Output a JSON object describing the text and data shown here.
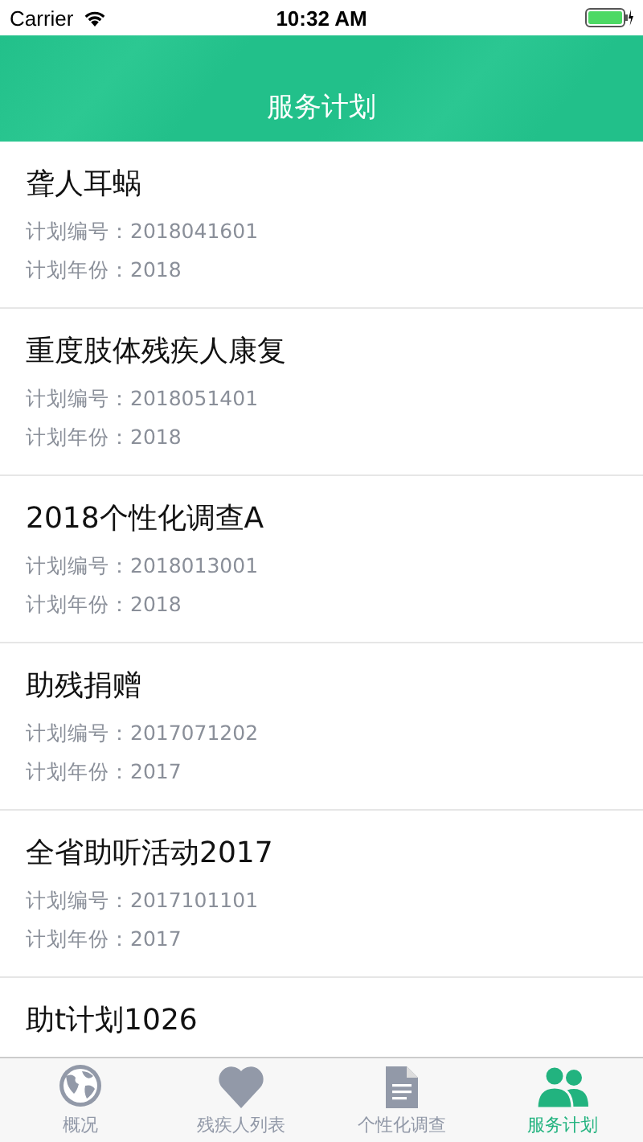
{
  "status_bar": {
    "carrier": "Carrier",
    "time": "10:32 AM"
  },
  "header": {
    "title": "服务计划"
  },
  "plans": [
    {
      "title": "聋人耳蜗",
      "number_label": "计划编号：",
      "number": "2018041601",
      "year_label": "计划年份：",
      "year": "2018"
    },
    {
      "title": "重度肢体残疾人康复",
      "number_label": "计划编号：",
      "number": "2018051401",
      "year_label": "计划年份：",
      "year": "2018"
    },
    {
      "title": "2018个性化调查A",
      "number_label": "计划编号：",
      "number": "2018013001",
      "year_label": "计划年份：",
      "year": "2018"
    },
    {
      "title": "助残捐赠",
      "number_label": "计划编号：",
      "number": "2017071202",
      "year_label": "计划年份：",
      "year": "2017"
    },
    {
      "title": "全省助听活动2017",
      "number_label": "计划编号：",
      "number": "2017101101",
      "year_label": "计划年份：",
      "year": "2017"
    },
    {
      "title": "助t计划1026"
    }
  ],
  "tabs": [
    {
      "label": "概况",
      "kind": "globe",
      "selected": false
    },
    {
      "label": "残疾人列表",
      "kind": "heart",
      "selected": false
    },
    {
      "label": "个性化调查",
      "kind": "document",
      "selected": false
    },
    {
      "label": "服务计划",
      "kind": "people",
      "selected": true
    }
  ]
}
